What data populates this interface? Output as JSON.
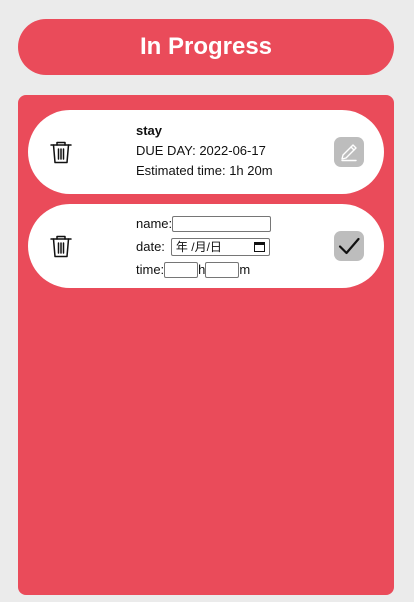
{
  "colors": {
    "accent": "#ea4b5a",
    "background": "#ebebeb",
    "card": "#ffffff",
    "button_gray": "#bdbdbd"
  },
  "header": {
    "title": "In Progress"
  },
  "tasks": [
    {
      "name": "stay",
      "due_label": "DUE DAY: 2022-06-17",
      "estimate_label": "Estimated time: 1h 20m",
      "delete_icon": "trash-icon",
      "action_icon": "pencil-icon"
    }
  ],
  "new_task_form": {
    "delete_icon": "trash-icon",
    "name_label": "name:",
    "name_value": "",
    "date_label": "date:",
    "date_placeholder": "年 /月/日",
    "date_icon": "calendar-icon",
    "time_label": "time:",
    "hours_value": "",
    "hours_unit": "h",
    "minutes_value": "",
    "minutes_unit": "m",
    "confirm_icon": "checkmark-icon"
  }
}
